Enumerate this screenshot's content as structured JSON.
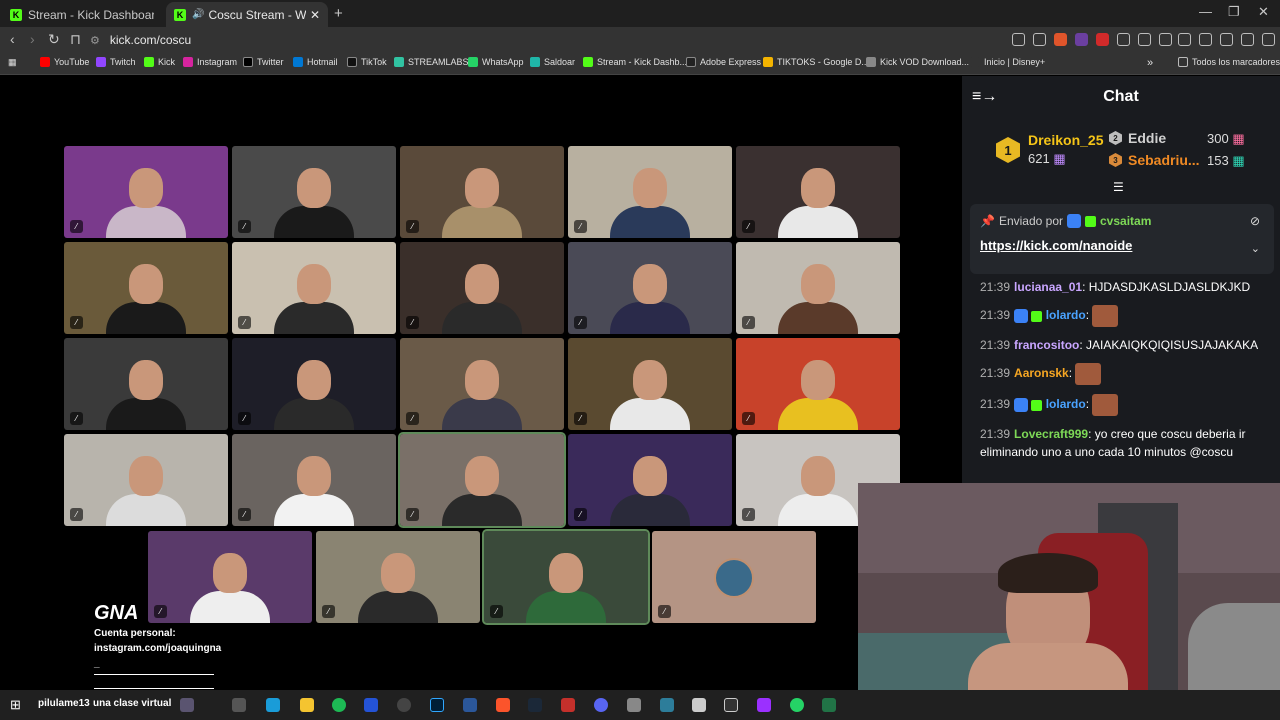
{
  "tabs": [
    {
      "label": "Stream - Kick Dashboard",
      "fav": "K"
    },
    {
      "label": "Coscu Stream - Watch Live on Kick",
      "fav": "K"
    }
  ],
  "new_tab_label": "+",
  "url": "kick.com/coscu",
  "bookmarks": [
    "YouTube",
    "Twitch",
    "Kick",
    "Instagram",
    "Twitter",
    "Hotmail",
    "TikTok",
    "STREAMLABS",
    "WhatsApp",
    "Saldoar",
    "Stream - Kick Dashb...",
    "Adobe Express",
    "TIKTOKS - Google D...",
    "Kick VOD Download...",
    "Inicio | Disney+",
    "Todos los marcadores"
  ],
  "overlay": {
    "logo": "GNA",
    "line1": "Cuenta personal:",
    "line2": "instagram.com/joaquingna",
    "line3": "_"
  },
  "chat": {
    "title": "Chat",
    "leaderboard": [
      {
        "rank": "1",
        "name": "Dreikon_25",
        "count": "621"
      },
      {
        "rank": "2",
        "name": "Eddie",
        "count": "300"
      },
      {
        "rank": "3",
        "name": "Sebadriu...",
        "count": "153"
      }
    ],
    "pinned": {
      "sent_by_label": "Enviado por",
      "author": "cvsaitam",
      "link": "https://kick.com/nanoide"
    },
    "messages": [
      {
        "time": "21:39",
        "user": "lucianaa_01",
        "text": "HJDASDJKASLDJASLDKJKD",
        "color": "#c9a6ff"
      },
      {
        "time": "21:39",
        "user": "lolardo",
        "text": "",
        "color": "#4aa3ff"
      },
      {
        "time": "21:39",
        "user": "francositoo",
        "text": "JAIAKAIQKQIQISUSJAJAKAKA",
        "color": "#c9a6ff"
      },
      {
        "time": "21:39",
        "user": "Aaronskk",
        "text": "",
        "color": "#f5a623"
      },
      {
        "time": "21:39",
        "user": "lolardo",
        "text": "",
        "color": "#4aa3ff"
      },
      {
        "time": "21:39",
        "user": "Lovecraft999",
        "text": "yo creo que coscu deberia ir eliminando uno a uno cada 10 minutos @coscu",
        "color": "#7ed957"
      }
    ]
  },
  "taskbar": {
    "notice_user": "pilulame13",
    "notice_text": "una clase virtual"
  }
}
